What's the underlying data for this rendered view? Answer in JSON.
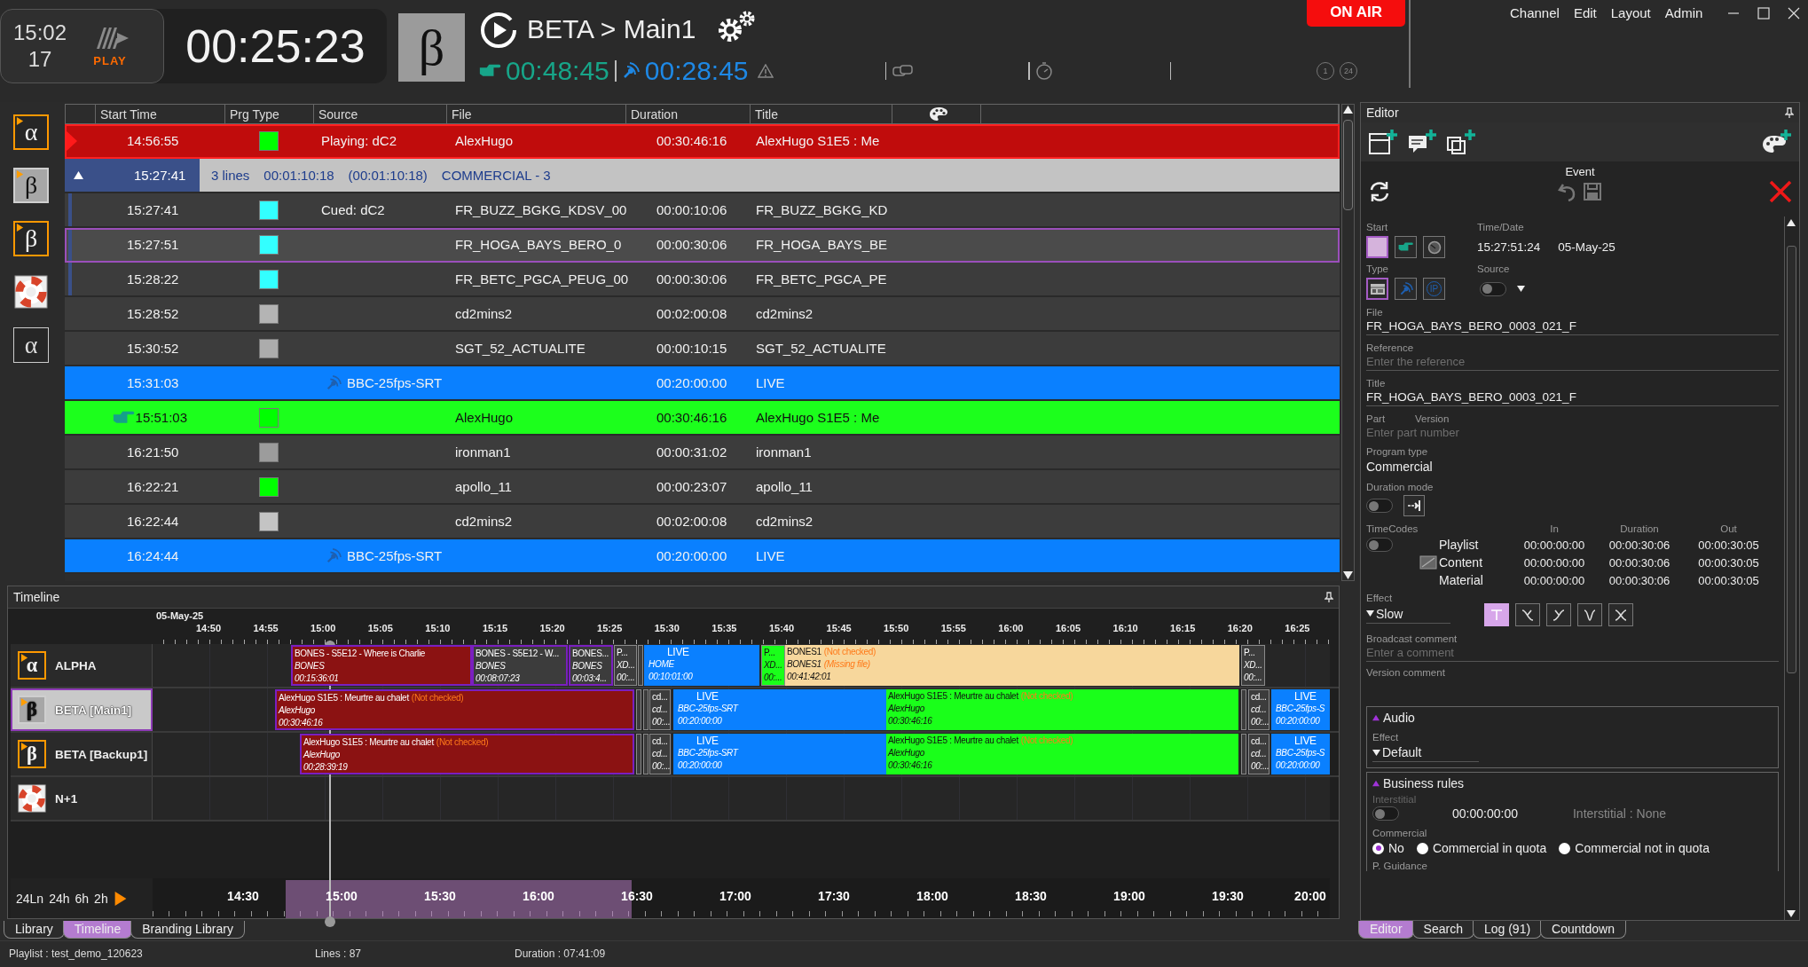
{
  "header": {
    "clock_time": "15:02",
    "clock_seconds": "17",
    "logo_text": "PLAY",
    "countdown": "00:25:23",
    "channel_symbol": "β",
    "channel_title": "BETA > Main1",
    "next_time": "00:48:45",
    "live_time": "00:28:45",
    "counters": [
      "1",
      "24"
    ],
    "on_air": "ON AIR"
  },
  "menu": [
    "Channel",
    "Edit",
    "Layout",
    "Admin"
  ],
  "channels": [
    {
      "kind": "letter",
      "symbol": "α",
      "active": true,
      "selected": false
    },
    {
      "kind": "letter",
      "symbol": "β",
      "active": true,
      "selected": true
    },
    {
      "kind": "letter",
      "symbol": "β",
      "active": true,
      "selected": false
    },
    {
      "kind": "lifebuoy",
      "selected": false
    },
    {
      "kind": "letter",
      "symbol": "α",
      "active": false,
      "selected": false
    }
  ],
  "playlist": {
    "columns": [
      "Start Time",
      "Prg Type",
      "Source",
      "File",
      "Duration",
      "Title"
    ],
    "rows": [
      {
        "kind": "playing",
        "selected": false,
        "start": "14:56:55",
        "color": "#00ff00",
        "source": "Playing: dC2",
        "file": "AlexHugo",
        "duration": "00:30:46:16",
        "title": "AlexHugo S1E5 : Me"
      },
      {
        "kind": "group",
        "expanded": true,
        "start": "15:27:41",
        "summary": [
          "3 lines",
          "00:01:10:18",
          "(00:01:10:18)",
          "COMMERCIAL - 3"
        ]
      },
      {
        "kind": "child",
        "selected": false,
        "start": "15:27:41",
        "color": "#33ffff",
        "source": "Cued: dC2",
        "file": "FR_BUZZ_BGKG_KDSV_00",
        "duration": "00:00:10:06",
        "title": "FR_BUZZ_BGKG_KD"
      },
      {
        "kind": "child",
        "selected": true,
        "start": "15:27:51",
        "color": "#33ffff",
        "file": "FR_HOGA_BAYS_BERO_0",
        "duration": "00:00:30:06",
        "title": "FR_HOGA_BAYS_BE"
      },
      {
        "kind": "child",
        "selected": false,
        "start": "15:28:22",
        "color": "#33ffff",
        "file": "FR_BETC_PGCA_PEUG_00",
        "duration": "00:00:30:06",
        "title": "FR_BETC_PGCA_PE"
      },
      {
        "kind": "item",
        "selected": false,
        "start": "15:28:52",
        "color": "#b4b4b4",
        "file": "cd2mins2",
        "duration": "00:02:00:08",
        "title": "cd2mins2"
      },
      {
        "kind": "item",
        "selected": false,
        "start": "15:30:52",
        "color": "#acacac",
        "file": "SGT_52_ACTUALITE",
        "duration": "00:00:10:15",
        "title": "SGT_52_ACTUALITE"
      },
      {
        "kind": "live",
        "selected": false,
        "start": "15:31:03",
        "source": "BBC-25fps-SRT",
        "duration": "00:20:00:00",
        "title": "LIVE"
      },
      {
        "kind": "next",
        "selected": false,
        "start": "15:51:03",
        "color": "#00ff00",
        "file": "AlexHugo",
        "duration": "00:30:46:16",
        "title": "AlexHugo S1E5 : Me"
      },
      {
        "kind": "item",
        "selected": false,
        "start": "16:21:50",
        "color": "#9c9c9c",
        "file": "ironman1",
        "duration": "00:00:31:02",
        "title": "ironman1"
      },
      {
        "kind": "item",
        "selected": false,
        "start": "16:22:21",
        "color": "#00ff00",
        "file": "apollo_11",
        "duration": "00:00:23:07",
        "title": "apollo_11"
      },
      {
        "kind": "item",
        "selected": false,
        "start": "16:22:44",
        "color": "#c4c4c4",
        "file": "cd2mins2",
        "duration": "00:02:00:08",
        "title": "cd2mins2"
      },
      {
        "kind": "live",
        "selected": false,
        "start": "16:24:44",
        "source": "BBC-25fps-SRT",
        "duration": "00:20:00:00",
        "title": "LIVE"
      }
    ]
  },
  "timeline": {
    "title": "Timeline",
    "date": "05-May-25",
    "ticks": [
      "14:50",
      "14:55",
      "15:00",
      "15:05",
      "15:10",
      "15:15",
      "15:20",
      "15:25",
      "15:30",
      "15:35",
      "15:40",
      "15:45",
      "15:50",
      "15:55",
      "16:00",
      "16:05",
      "16:10",
      "16:15",
      "16:20",
      "16:25"
    ],
    "tracks": [
      {
        "name": "ALPHA",
        "kind": "letter",
        "symbol": "α",
        "selected": false,
        "clips": [
          {
            "kind": "program",
            "color": "#8b1212",
            "title": "BONES - S5E12 - Where is Charlie",
            "subtitle": "BONES",
            "duration": "00:15:36:01"
          },
          {
            "kind": "program",
            "color": "#3c3c3c",
            "title": "BONES - S5E12 - W...",
            "subtitle": "BONES",
            "duration": "00:08:07:23"
          },
          {
            "kind": "program",
            "color": "#3c3c3c",
            "title": "BONES...",
            "subtitle": "BONES",
            "duration": "00:03:4..."
          },
          {
            "kind": "filler",
            "color": "#3c3c3c",
            "title": "P...",
            "subtitle": "XD...",
            "duration": "00:..."
          },
          {
            "kind": "marker",
            "color": "#3c3c3c"
          },
          {
            "kind": "live",
            "color": "#0a80ff",
            "title": "LIVE",
            "subtitle": "HOME",
            "duration": "00:10:01:00"
          },
          {
            "kind": "filler",
            "color": "#1aff1a",
            "title": "P...",
            "subtitle": "XD...",
            "duration": "00:..."
          },
          {
            "kind": "item",
            "color": "#f7d79c",
            "title": "BONES1",
            "status": "(Not checked)",
            "subtitle": "BONES1",
            "sub_status": "(Missing file)",
            "duration": "00:41:42:01"
          },
          {
            "kind": "filler",
            "color": "#3c3c3c",
            "title": "P...",
            "subtitle": "XD...",
            "duration": "00:..."
          }
        ]
      },
      {
        "name": "BETA [Main1]",
        "kind": "letter",
        "symbol": "β",
        "selected": true,
        "clips": [
          {
            "kind": "program",
            "color": "#8b1212",
            "title": "AlexHugo S1E5 : Meurtre au chalet",
            "status": "(Not checked)",
            "subtitle": "AlexHugo",
            "duration": "00:30:46:16"
          },
          {
            "kind": "marker",
            "color": "#3c3c3c"
          },
          {
            "kind": "marker",
            "color": "#3c3c3c"
          },
          {
            "kind": "filler",
            "color": "#3c3c3c",
            "title": "cd...",
            "subtitle": "cd...",
            "duration": "00:..."
          },
          {
            "kind": "live",
            "color": "#0a80ff",
            "title": "LIVE",
            "subtitle": "BBC-25fps-SRT",
            "duration": "00:20:00:00"
          },
          {
            "kind": "item",
            "color": "#1aff1a",
            "title": "AlexHugo S1E5 : Meurtre au chalet",
            "status": "(Not checked)",
            "subtitle": "AlexHugo",
            "duration": "00:30:46:16"
          },
          {
            "kind": "marker",
            "color": "#3c3c3c"
          },
          {
            "kind": "filler",
            "color": "#3c3c3c",
            "title": "cd...",
            "subtitle": "cd...",
            "duration": "00:..."
          },
          {
            "kind": "live",
            "color": "#0a80ff",
            "title": "LIVE",
            "subtitle": "BBC-25fps-S",
            "duration": "00:20:00:00"
          }
        ]
      },
      {
        "name": "BETA [Backup1]",
        "kind": "letter",
        "symbol": "β",
        "selected": false,
        "clips": [
          {
            "kind": "program",
            "color": "#8b1212",
            "title": "AlexHugo S1E5 : Meurtre au chalet",
            "status": "(Not checked)",
            "subtitle": "AlexHugo",
            "duration": "00:28:39:19"
          },
          {
            "kind": "marker",
            "color": "#3c3c3c"
          },
          {
            "kind": "marker",
            "color": "#3c3c3c"
          },
          {
            "kind": "filler",
            "color": "#3c3c3c",
            "title": "cd...",
            "subtitle": "cd...",
            "duration": "00:..."
          },
          {
            "kind": "live",
            "color": "#0a80ff",
            "title": "LIVE",
            "subtitle": "BBC-25fps-SRT",
            "duration": "00:20:00:00"
          },
          {
            "kind": "item",
            "color": "#1aff1a",
            "title": "AlexHugo S1E5 : Meurtre au chalet",
            "status": "(Not checked)",
            "subtitle": "AlexHugo",
            "duration": "00:30:46:16"
          },
          {
            "kind": "marker",
            "color": "#3c3c3c"
          },
          {
            "kind": "filler",
            "color": "#3c3c3c",
            "title": "cd...",
            "subtitle": "cd...",
            "duration": "00:..."
          },
          {
            "kind": "live",
            "color": "#0a80ff",
            "title": "LIVE",
            "subtitle": "BBC-25fps-S",
            "duration": "00:20:00:00"
          }
        ]
      },
      {
        "name": "N+1",
        "kind": "lifebuoy",
        "selected": false
      }
    ],
    "zoom_options": [
      "24Ln",
      "24h",
      "6h",
      "2h"
    ],
    "overview_ticks": [
      "14:30",
      "15:00",
      "15:30",
      "16:00",
      "16:30",
      "17:00",
      "17:30",
      "18:00",
      "18:30",
      "19:00",
      "19:30",
      "20:00"
    ]
  },
  "bottom_tabs": [
    {
      "label": "Library",
      "selected": false
    },
    {
      "label": "Timeline",
      "selected": true
    },
    {
      "label": "Branding Library",
      "selected": false
    }
  ],
  "editor": {
    "title": "Editor",
    "section": "Event",
    "start_label": "Start",
    "timedate_label": "Time/Date",
    "time_value": "15:27:51:24",
    "date_value": "05-May-25",
    "start_modes": [
      {
        "kind": "swatch",
        "selected": true
      },
      {
        "kind": "hand",
        "selected": false
      },
      {
        "kind": "clock",
        "selected": false
      }
    ],
    "type_label": "Type",
    "source_label": "Source",
    "source_on": false,
    "type_modes": [
      {
        "kind": "file",
        "selected": true
      },
      {
        "kind": "live",
        "selected": false
      },
      {
        "kind": "ip",
        "label": "IP",
        "selected": false
      }
    ],
    "fields": [
      {
        "label": "File",
        "value": "FR_HOGA_BAYS_BERO_0003_021_F"
      },
      {
        "label": "Reference",
        "placeholder": "Enter the reference"
      },
      {
        "label": "Title",
        "value": "FR_HOGA_BAYS_BERO_0003_021_F"
      }
    ],
    "part_label": "Part",
    "version_label": "Version",
    "part_placeholder": "Enter part number",
    "program_type_label": "Program type",
    "program_type": "Commercial",
    "duration_mode_label": "Duration mode",
    "duration_mode_on": false,
    "timecodes_label": "TimeCodes",
    "timecodes_on": false,
    "timecode_columns": [
      "In",
      "Duration",
      "Out"
    ],
    "timecode_rows": [
      {
        "label": "Playlist",
        "has_icon": false,
        "values": [
          "00:00:00:00",
          "00:00:30:06",
          "00:00:30:05"
        ]
      },
      {
        "label": "Content",
        "has_icon": true,
        "values": [
          "00:00:00:00",
          "00:00:30:06",
          "00:00:30:05"
        ]
      },
      {
        "label": "Material",
        "has_icon": false,
        "values": [
          "00:00:00:00",
          "00:00:30:06",
          "00:00:30:05"
        ]
      }
    ],
    "effect_label": "Effect",
    "effect": "Slow",
    "effect_buttons": [
      {
        "kind": "cut",
        "selected": true
      },
      {
        "kind": "fade-in",
        "selected": false
      },
      {
        "kind": "fade-out",
        "selected": false
      },
      {
        "kind": "dip",
        "selected": false
      },
      {
        "kind": "cross",
        "selected": false
      }
    ],
    "broadcast_comment_label": "Broadcast comment",
    "broadcast_comment_placeholder": "Enter a comment",
    "version_comment_label": "Version comment",
    "audio": {
      "title": "Audio",
      "expanded": true,
      "effect_label": "Effect",
      "effect": "Default"
    },
    "business_rules": {
      "title": "Business rules",
      "expanded": true,
      "interstitial_label": "Interstitial",
      "interstitial_on": false,
      "interstitial_time": "00:00:00:00",
      "interstitial_value": "Interstitial : None",
      "commercial_label": "Commercial",
      "commercial_options": [
        {
          "label": "No",
          "selected": true
        },
        {
          "label": "Commercial in quota",
          "selected": false
        },
        {
          "label": "Commercial not in quota",
          "selected": false
        }
      ],
      "guidance_label": "P. Guidance"
    }
  },
  "editor_tabs": [
    {
      "label": "Editor",
      "selected": true
    },
    {
      "label": "Search",
      "selected": false
    },
    {
      "label": "Log (91)",
      "selected": false
    },
    {
      "label": "Countdown",
      "selected": false
    }
  ],
  "status_bar": {
    "playlist": "Playlist : test_demo_120623",
    "lines": "Lines : 87",
    "duration": "Duration : 07:41:09"
  }
}
